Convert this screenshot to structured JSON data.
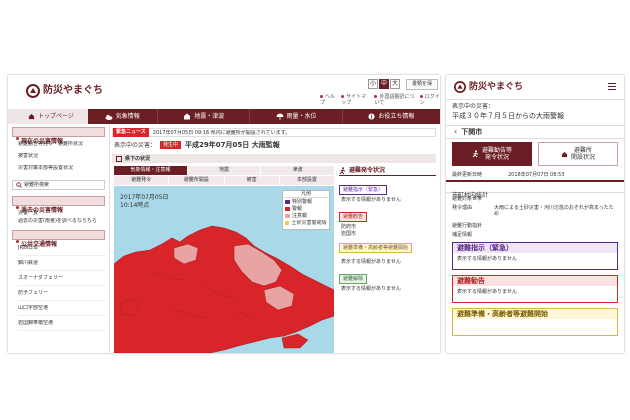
{
  "site": {
    "name": "防災やまぐち"
  },
  "desktop": {
    "util": {
      "font_size_buttons": [
        "小",
        "中",
        "大"
      ],
      "font_size_selected": "中",
      "doc_button": "書類を保",
      "links": [
        "ヘルプ",
        "サイトマップ",
        "外国語翻訳について",
        "ログイン"
      ]
    },
    "nav": [
      "トップページ",
      "気象情報",
      "地震・津波",
      "雨量・水位",
      "お役立ち情報"
    ],
    "news": {
      "label": "緊急ニュース",
      "text": "2017年07月05日 09:16 県内に避難所が開設されています。"
    },
    "disaster": {
      "label": "表示中の災害：",
      "badge": "発生中",
      "title": "平成29年07月05日 大雨監報"
    },
    "section_title": "県下の状況",
    "map_tabs_row1": [
      "気象情報・注意報",
      "地震",
      "津波"
    ],
    "map_tabs_row2": [
      "避難発令",
      "避難所開設",
      "被害",
      "本部設置"
    ],
    "map_timestamp": [
      "2017年07月05日",
      "10:14時点"
    ],
    "legend": {
      "title": "凡例",
      "items": [
        "特別警報",
        "警報",
        "注意報",
        "土砂災害警戒情報"
      ]
    },
    "sidebar": {
      "sections": [
        {
          "title": "現在の災害情報",
          "items": [
            "避難勧告等発令・避難所状況",
            "被害状況",
            "災害対策本部等設置状況"
          ]
        },
        {
          "title": "",
          "items": [
            "避難所検索"
          ]
        },
        {
          "title": "過去の災害情報",
          "items": [
            "災害一覧",
            "過去の災害(雨量)を調べるならちら"
          ]
        },
        {
          "title": "公共交通情報",
          "items": [
            "JR西日本",
            "錦川鉄道",
            "スオーナダフェリー",
            "防予フェリー",
            "山口宇部空港",
            "岩国錦帯橋空港"
          ]
        }
      ]
    },
    "evac": {
      "title": "避難発令状況",
      "blocks": [
        {
          "label": "避難指示（緊急）",
          "lines": [
            "表示する情報がありません"
          ]
        },
        {
          "label": "避難勧告",
          "lines": [
            "防府市",
            "岩国市"
          ]
        },
        {
          "label": "避難準備・高齢者等避難開始",
          "lines": [
            "表示する情報がありません"
          ]
        },
        {
          "label": "避難解除",
          "lines": [
            "表示する情報がありません"
          ]
        }
      ]
    }
  },
  "mobile": {
    "disaster_label": "表示中の災害：",
    "disaster_title": "平成３０年７月５日からの大雨警報",
    "city": "下関市",
    "btn_evac": [
      "避難勧告等",
      "発令状況"
    ],
    "btn_shelter": [
      "避難所",
      "開設状況"
    ],
    "updated": {
      "label": "最終更新日時",
      "value": "2018年07月07日 08:53"
    },
    "area": "市町村内総計",
    "rows": [
      {
        "label": "避難対象世帯",
        "value": ""
      },
      {
        "label": "発令理由",
        "value": "大雨による土砂災害・河川氾濫のおそれが高まったため"
      },
      {
        "label": "避難行動指針",
        "value": ""
      },
      {
        "label": "補足情報",
        "value": ""
      }
    ],
    "cards": [
      {
        "title": "避難指示（緊急）",
        "text": "表示する情報がありません"
      },
      {
        "title": "避難勧告",
        "text": "表示する情報がありません"
      },
      {
        "title": "避難準備・高齢者等避難開始",
        "text": ""
      }
    ]
  },
  "colors": {
    "maroon": "#6b1f24",
    "warning_red": "#d8252a",
    "advisory_pink": "#e8a3a3",
    "special_purple": "#5b2a86",
    "landslide_yellow": "#f2c94c",
    "sea_blue": "#a9d8e8"
  }
}
